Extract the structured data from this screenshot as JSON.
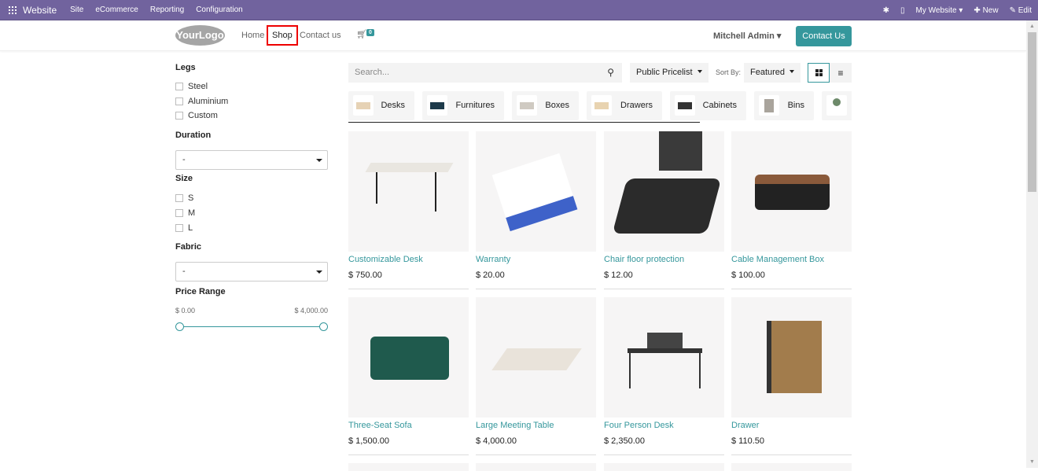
{
  "topbar": {
    "brand": "Website",
    "menus": [
      "Site",
      "eCommerce",
      "Reporting",
      "Configuration"
    ],
    "website": "My Website",
    "new": "New",
    "edit": "Edit"
  },
  "header": {
    "logo": "YourLogo",
    "nav": [
      "Home",
      "Shop",
      "Contact us"
    ],
    "cart_count": "0",
    "user": "Mitchell Admin",
    "cta": "Contact Us"
  },
  "filters": {
    "legs_title": "Legs",
    "legs": [
      "Steel",
      "Aluminium",
      "Custom"
    ],
    "duration_title": "Duration",
    "duration_value": "-",
    "size_title": "Size",
    "sizes": [
      "S",
      "M",
      "L"
    ],
    "fabric_title": "Fabric",
    "fabric_value": "-",
    "price_title": "Price Range",
    "price_min": "$ 0.00",
    "price_max": "$ 4,000.00"
  },
  "toolbar": {
    "search_placeholder": "Search...",
    "pricelist": "Public Pricelist",
    "sort_label": "Sort By:",
    "sort_value": "Featured"
  },
  "categories": [
    "Desks",
    "Furnitures",
    "Boxes",
    "Drawers",
    "Cabinets",
    "Bins"
  ],
  "products": [
    {
      "name": "Customizable Desk",
      "price": "$ 750.00"
    },
    {
      "name": "Warranty",
      "price": "$ 20.00"
    },
    {
      "name": "Chair floor protection",
      "price": "$ 12.00"
    },
    {
      "name": "Cable Management Box",
      "price": "$ 100.00"
    },
    {
      "name": "Three-Seat Sofa",
      "price": "$ 1,500.00"
    },
    {
      "name": "Large Meeting Table",
      "price": "$ 4,000.00"
    },
    {
      "name": "Four Person Desk",
      "price": "$ 2,350.00"
    },
    {
      "name": "Drawer",
      "price": "$ 110.50"
    }
  ],
  "colors": {
    "topbar": "#71639e",
    "accent": "#35979c"
  }
}
